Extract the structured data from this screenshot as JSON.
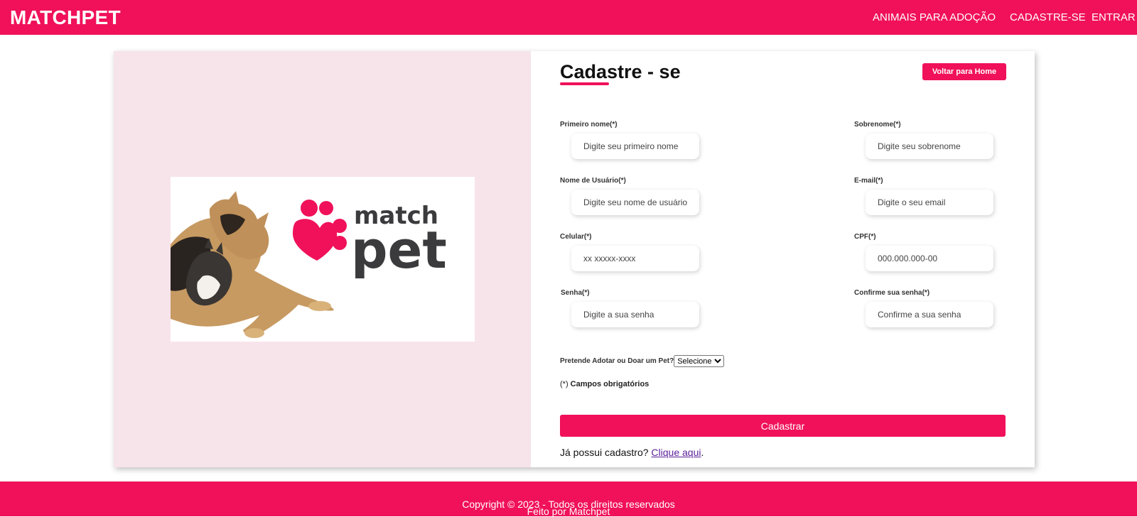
{
  "header": {
    "brand": "MATCHPET",
    "nav": {
      "animais": "ANIMAIS PARA ADOÇÃO",
      "cadastre": "CADASTRE-SE",
      "entrar": "ENTRAR"
    }
  },
  "logo": {
    "word_top": "match",
    "word_bottom": "pet",
    "colors": {
      "paw": "#f0115a",
      "text": "#3b3b3d"
    }
  },
  "form": {
    "title": "Cadastre - se",
    "home_button": "Voltar para Home",
    "fields": {
      "first_name": {
        "label": "Primeiro nome(*)",
        "placeholder": "Digite seu primeiro nome"
      },
      "last_name": {
        "label": "Sobrenome(*)",
        "placeholder": "Digite seu sobrenome"
      },
      "username": {
        "label": "Nome de Usuário(*)",
        "placeholder": "Digite seu nome de usuário"
      },
      "email": {
        "label": "E-mail(*)",
        "placeholder": "Digite o seu email"
      },
      "phone": {
        "label": "Celular(*)",
        "placeholder": "xx xxxxx-xxxx"
      },
      "cpf": {
        "label": "CPF(*)",
        "placeholder": "000.000.000-00"
      },
      "password": {
        "label": "Senha(*)",
        "placeholder": "Digite a sua senha"
      },
      "confirm_password": {
        "label": "Confirme sua senha(*)",
        "placeholder": "Confirme a sua senha"
      }
    },
    "adopt_select": {
      "label": "Pretende Adotar ou Doar um Pet?",
      "selected": "Selecione"
    },
    "required_prefix": "(*)",
    "required_text": " Campos obrigatórios",
    "submit": "Cadastrar",
    "login_prompt": "Já possui cadastro?",
    "login_link": "Clique aqui",
    "login_suffix": "."
  },
  "footer": {
    "copyright": "Copyright © 2023 - Todos os direitos reservados",
    "made_by": "Feito por Matchpet"
  },
  "colors": {
    "brand": "#f0115a",
    "panel": "#f7e4ea"
  }
}
